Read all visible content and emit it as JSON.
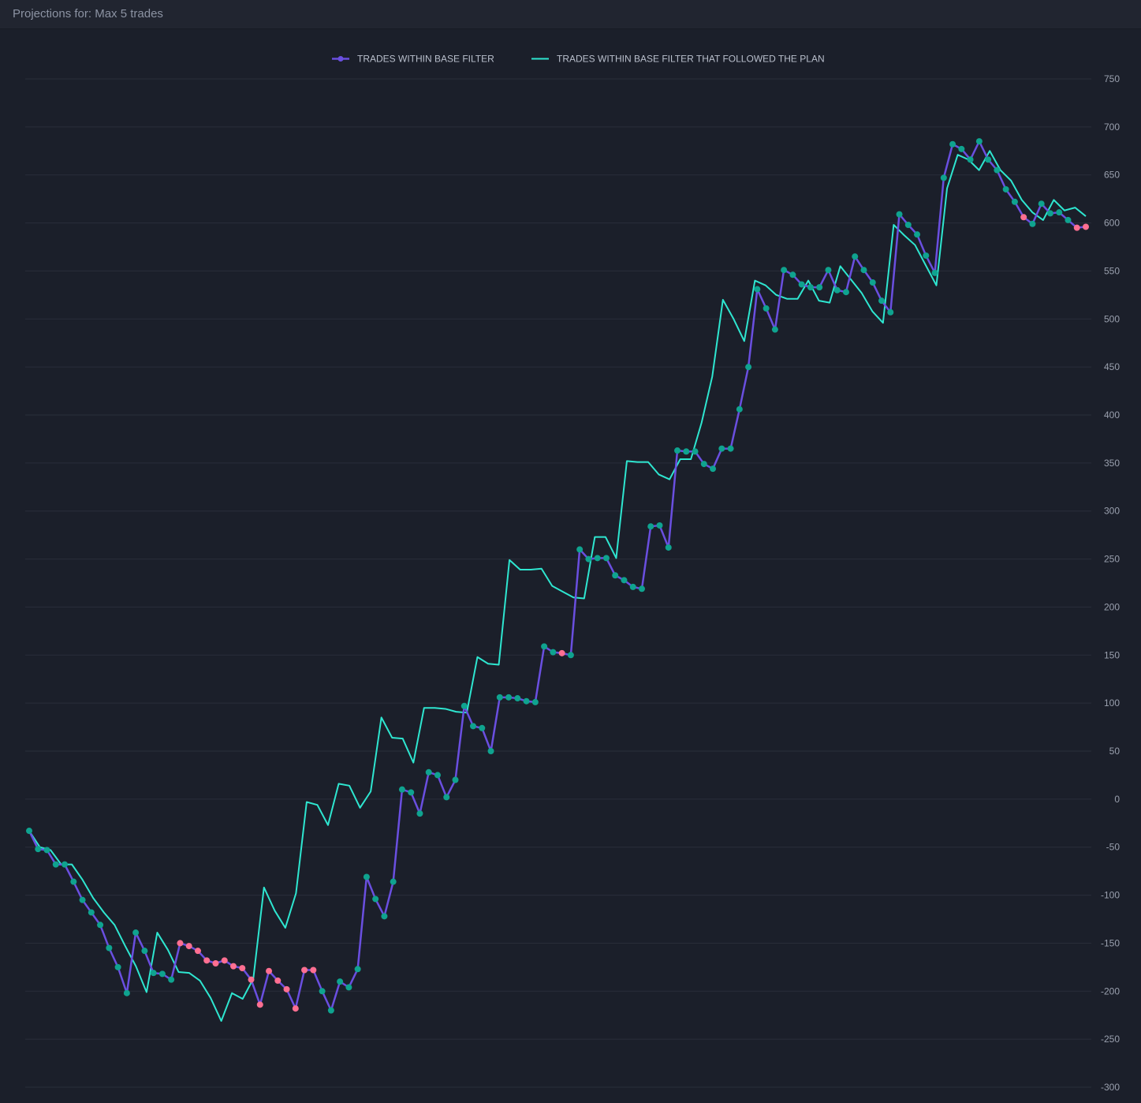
{
  "header": {
    "title": "Projections for: Max 5 trades"
  },
  "colors": {
    "background": "#1b1f2a",
    "grid": "#2a2f3b",
    "tick_text": "#9aa0ae",
    "series_primary": "#6a4fe0",
    "series_plan": "#2ee6d0",
    "marker_win": "#0fa38f",
    "marker_loss": "#ff6f91"
  },
  "chart_data": {
    "type": "line",
    "title": "",
    "xlabel": "",
    "ylabel": "",
    "ylim": [
      -300,
      750
    ],
    "yticks": [
      750,
      700,
      650,
      600,
      550,
      500,
      450,
      400,
      350,
      300,
      250,
      200,
      150,
      100,
      50,
      0,
      -50,
      -100,
      -150,
      -200,
      -250,
      -300
    ],
    "y_axis_side": "right",
    "grid": true,
    "legend_position": "top-center",
    "series": [
      {
        "name": "TRADES WITHIN BASE FILTER",
        "style": "line-with-markers",
        "values": [
          -33,
          -52,
          -53,
          -68,
          -68,
          -86,
          -105,
          -118,
          -131,
          -155,
          -175,
          -202,
          -139,
          -158,
          -181,
          -182,
          -188,
          -150,
          -153,
          -158,
          -168,
          -171,
          -168,
          -174,
          -176,
          -188,
          -214,
          -179,
          -189,
          -198,
          -218,
          -178,
          -178,
          -200,
          -220,
          -190,
          -196,
          -177,
          -81,
          -104,
          -122,
          -86,
          10,
          7,
          -15,
          28,
          25,
          2,
          20,
          97,
          76,
          74,
          50,
          106,
          106,
          105,
          102,
          101,
          159,
          153,
          152,
          150,
          260,
          250,
          251,
          251,
          233,
          228,
          221,
          219,
          284,
          285,
          262,
          363,
          362,
          362,
          349,
          344,
          365,
          365,
          406,
          450,
          531,
          511,
          489,
          551,
          546,
          536,
          533,
          533,
          551,
          530,
          528,
          565,
          551,
          538,
          519,
          507,
          609,
          598,
          588,
          566,
          548,
          647,
          682,
          677,
          666,
          685,
          666,
          655,
          635,
          622,
          606,
          599,
          620,
          610,
          611,
          603,
          595,
          596
        ],
        "marker_state": [
          "w",
          "w",
          "w",
          "w",
          "w",
          "w",
          "w",
          "w",
          "w",
          "w",
          "w",
          "w",
          "w",
          "w",
          "w",
          "w",
          "w",
          "l",
          "l",
          "l",
          "l",
          "l",
          "l",
          "l",
          "l",
          "l",
          "l",
          "l",
          "l",
          "l",
          "l",
          "l",
          "l",
          "w",
          "w",
          "w",
          "w",
          "w",
          "w",
          "w",
          "w",
          "w",
          "w",
          "w",
          "w",
          "w",
          "w",
          "w",
          "w",
          "w",
          "w",
          "w",
          "w",
          "w",
          "w",
          "w",
          "w",
          "w",
          "w",
          "w",
          "l",
          "w",
          "w",
          "w",
          "w",
          "w",
          "w",
          "w",
          "w",
          "w",
          "w",
          "w",
          "w",
          "w",
          "w",
          "w",
          "w",
          "w",
          "w",
          "w",
          "w",
          "w",
          "w",
          "w",
          "w",
          "w",
          "w",
          "w",
          "w",
          "w",
          "w",
          "w",
          "w",
          "w",
          "w",
          "w",
          "w",
          "w",
          "w",
          "w",
          "w",
          "w",
          "w",
          "w",
          "w",
          "w",
          "w",
          "w",
          "w",
          "w",
          "w",
          "w",
          "l",
          "w",
          "w",
          "w",
          "w",
          "w",
          "l",
          "l"
        ]
      },
      {
        "name": "TRADES WITHIN BASE FILTER THAT FOLLOWED THE PLAN",
        "style": "line",
        "values": [
          -33,
          -50,
          -53,
          -68,
          -68,
          -84,
          -103,
          -118,
          -131,
          -153,
          -174,
          -201,
          -139,
          -157,
          -180,
          -181,
          -189,
          -207,
          -231,
          -202,
          -208,
          -187,
          -92,
          -116,
          -134,
          -98,
          -3,
          -6,
          -27,
          16,
          14,
          -9,
          8,
          85,
          64,
          63,
          38,
          95,
          95,
          94,
          91,
          90,
          148,
          141,
          140,
          249,
          239,
          239,
          240,
          222,
          216,
          210,
          209,
          273,
          273,
          251,
          352,
          351,
          351,
          338,
          333,
          354,
          354,
          392,
          440,
          520,
          500,
          477,
          540,
          535,
          525,
          521,
          521,
          540,
          519,
          517,
          555,
          541,
          527,
          508,
          496,
          598,
          587,
          577,
          556,
          535,
          636,
          671,
          666,
          655,
          675,
          655,
          644,
          624,
          611,
          603,
          624,
          613,
          616,
          607
        ],
        "x_span": [
          0,
          119
        ]
      }
    ]
  }
}
